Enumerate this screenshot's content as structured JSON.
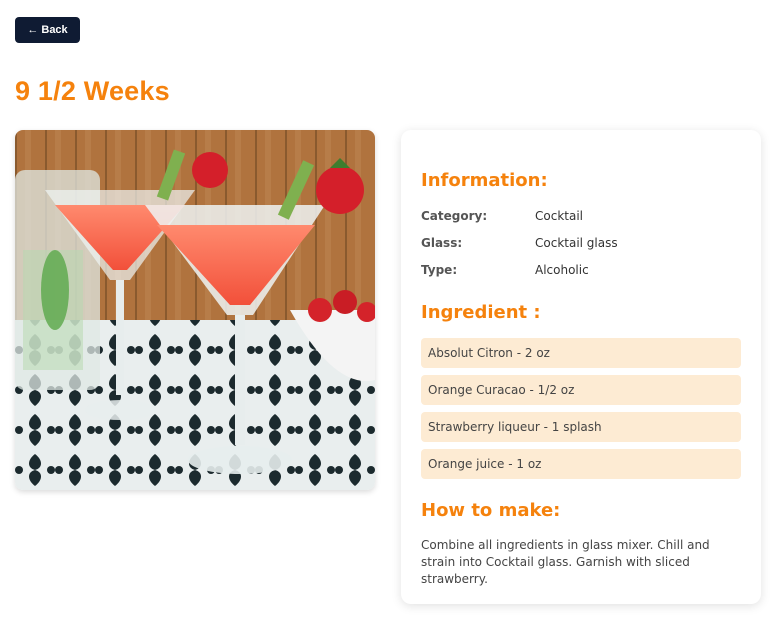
{
  "back_button": {
    "label": "← Back"
  },
  "drink": {
    "title": "9 1/2 Weeks",
    "image_alt": "9 1/2 Weeks cocktail"
  },
  "information": {
    "heading": "Information:",
    "rows": [
      {
        "key": "Category:",
        "value": "Cocktail"
      },
      {
        "key": "Glass:",
        "value": "Cocktail glass"
      },
      {
        "key": "Type:",
        "value": "Alcoholic"
      }
    ]
  },
  "ingredients": {
    "heading": "Ingredient :",
    "items": [
      "Absolut Citron - 2 oz",
      "Orange Curacao - 1/2 oz",
      "Strawberry liqueur - 1 splash",
      "Orange juice - 1 oz"
    ]
  },
  "how_to_make": {
    "heading": "How to make:",
    "text": "Combine all ingredients in glass mixer. Chill and strain into Cocktail glass. Garnish with sliced strawberry."
  },
  "colors": {
    "accent": "#f5820d",
    "button_bg": "#0f1b33",
    "ingredient_bg": "#fdebd3"
  }
}
